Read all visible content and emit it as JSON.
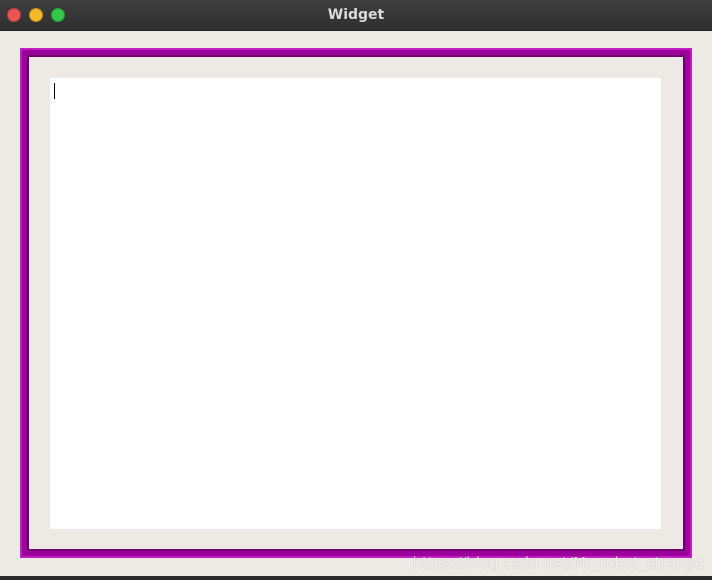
{
  "window": {
    "title": "Widget"
  },
  "colors": {
    "frame": "#9a009a",
    "window_background": "#edeae6",
    "text_area_background": "#ffffff",
    "close": "#ec5454",
    "minimize": "#f5b928",
    "maximize": "#33c948"
  },
  "editor": {
    "content": ""
  },
  "watermark": {
    "text": "https://blog.csdn.net/Mr_robot_strange"
  }
}
